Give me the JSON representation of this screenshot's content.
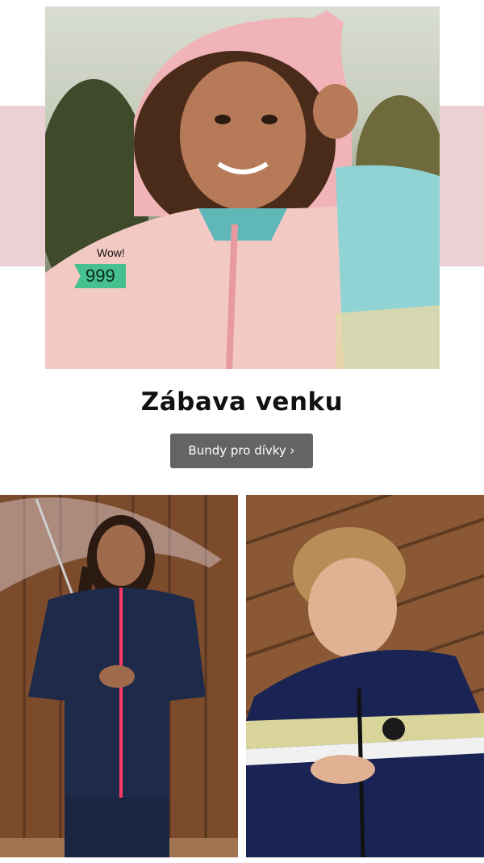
{
  "hero": {
    "image_alt": "girl in pastel gradient jacket with pink hood",
    "price_label": "Wow!",
    "price_value": "999",
    "accent_band_color": "#ebd1d4",
    "price_tag_color": "#47c08f"
  },
  "section": {
    "title": "Zábava venku",
    "button_label": "Bundy pro dívky ›",
    "button_color": "#636466"
  },
  "gallery": {
    "left_image_alt": "girl with umbrella in navy softshell jacket",
    "right_image_alt": "boy in navy striped jacket"
  }
}
